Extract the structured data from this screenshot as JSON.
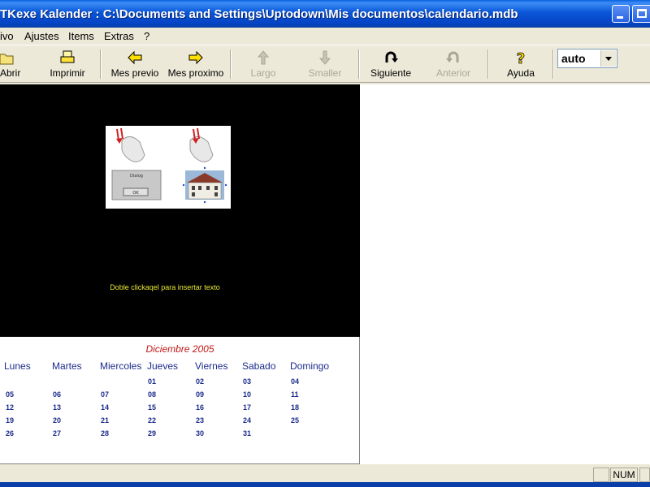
{
  "window": {
    "title": "TKexe Kalender : C:\\Documents and Settings\\Uptodown\\Mis documentos\\calendario.mdb"
  },
  "menu": {
    "items": [
      "ivo",
      "Ajustes",
      "Items",
      "Extras",
      "?"
    ]
  },
  "toolbar": {
    "buttons": [
      {
        "label": "Abrir",
        "icon": "open-folder-icon",
        "enabled": true
      },
      {
        "label": "Imprimir",
        "icon": "printer-icon",
        "enabled": true
      },
      {
        "label": "Mes previo",
        "icon": "arrow-left-icon",
        "enabled": true
      },
      {
        "label": "Mes proximo",
        "icon": "arrow-right-icon",
        "enabled": true
      },
      {
        "label": "Largo",
        "icon": "arrow-up-icon",
        "enabled": false
      },
      {
        "label": "Smaller",
        "icon": "arrow-down-icon",
        "enabled": false
      },
      {
        "label": "Siguiente",
        "icon": "next-icon",
        "enabled": true
      },
      {
        "label": "Anterior",
        "icon": "previous-icon",
        "enabled": false
      },
      {
        "label": "Ayuda",
        "icon": "help-icon",
        "enabled": true
      }
    ],
    "zoom_value": "auto"
  },
  "canvas": {
    "hint": "Doble clickaqel para insertar texto"
  },
  "thumb": {
    "dialog_title": "Dialog",
    "dialog_ok": "OK"
  },
  "calendar": {
    "title": "Diciembre 2005",
    "days": [
      "Lunes",
      "Martes",
      "Miercoles",
      "Jueves",
      "Viernes",
      "Sabado",
      "Domingo"
    ],
    "weeks": [
      [
        "",
        "",
        "",
        "01",
        "02",
        "03",
        "04"
      ],
      [
        "05",
        "06",
        "07",
        "08",
        "09",
        "10",
        "11"
      ],
      [
        "12",
        "13",
        "14",
        "15",
        "16",
        "17",
        "18"
      ],
      [
        "19",
        "20",
        "21",
        "22",
        "23",
        "24",
        "25"
      ],
      [
        "26",
        "27",
        "28",
        "29",
        "30",
        "31",
        ""
      ]
    ]
  },
  "status": {
    "num": "NUM"
  },
  "colors": {
    "titlebar": "#0a56d8",
    "calendar_title": "#c01818",
    "calendar_text": "#1c2c8c",
    "hint_text": "#e8e832"
  }
}
